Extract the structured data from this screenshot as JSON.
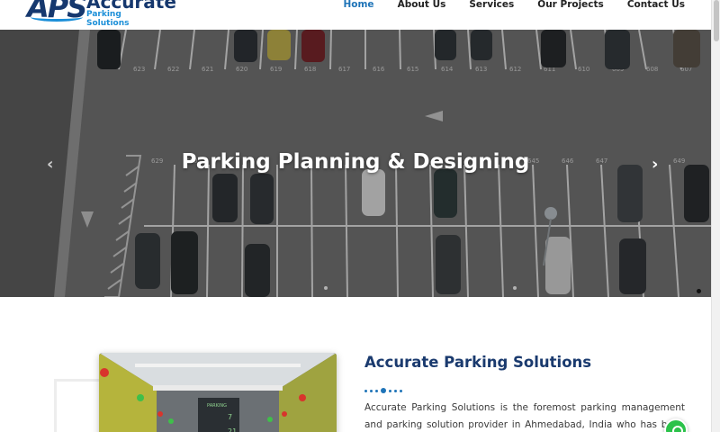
{
  "brand": {
    "logo_mark": "APS",
    "name": "Accurate",
    "tagline": "Parking Solutions",
    "primary_color": "#16386e",
    "accent_color": "#1c8fd8"
  },
  "nav": {
    "items": [
      {
        "label": "Home",
        "active": true
      },
      {
        "label": "About Us",
        "active": false
      },
      {
        "label": "Services",
        "active": false
      },
      {
        "label": "Our Projects",
        "active": false
      },
      {
        "label": "Contact Us",
        "active": false
      }
    ],
    "active_color": "#1f74b8"
  },
  "hero": {
    "title": "Parking Planning & Designing",
    "prev_icon": "chevron-left-icon",
    "next_icon": "chevron-right-icon",
    "prev_glyph": "‹",
    "next_glyph": "›",
    "slot_numbers_top": [
      "623",
      "622",
      "621",
      "620",
      "619",
      "618",
      "617",
      "616",
      "615",
      "614",
      "613",
      "612",
      "611",
      "610",
      "609",
      "608",
      "607"
    ]
  },
  "about": {
    "title": "Accurate Parking Solutions",
    "text": "Accurate Parking Solutions is the foremost parking management and parking solution provider in Ahmedabad, India who has been servi"
  },
  "floating": {
    "whatsapp_icon": "whatsapp-icon"
  }
}
